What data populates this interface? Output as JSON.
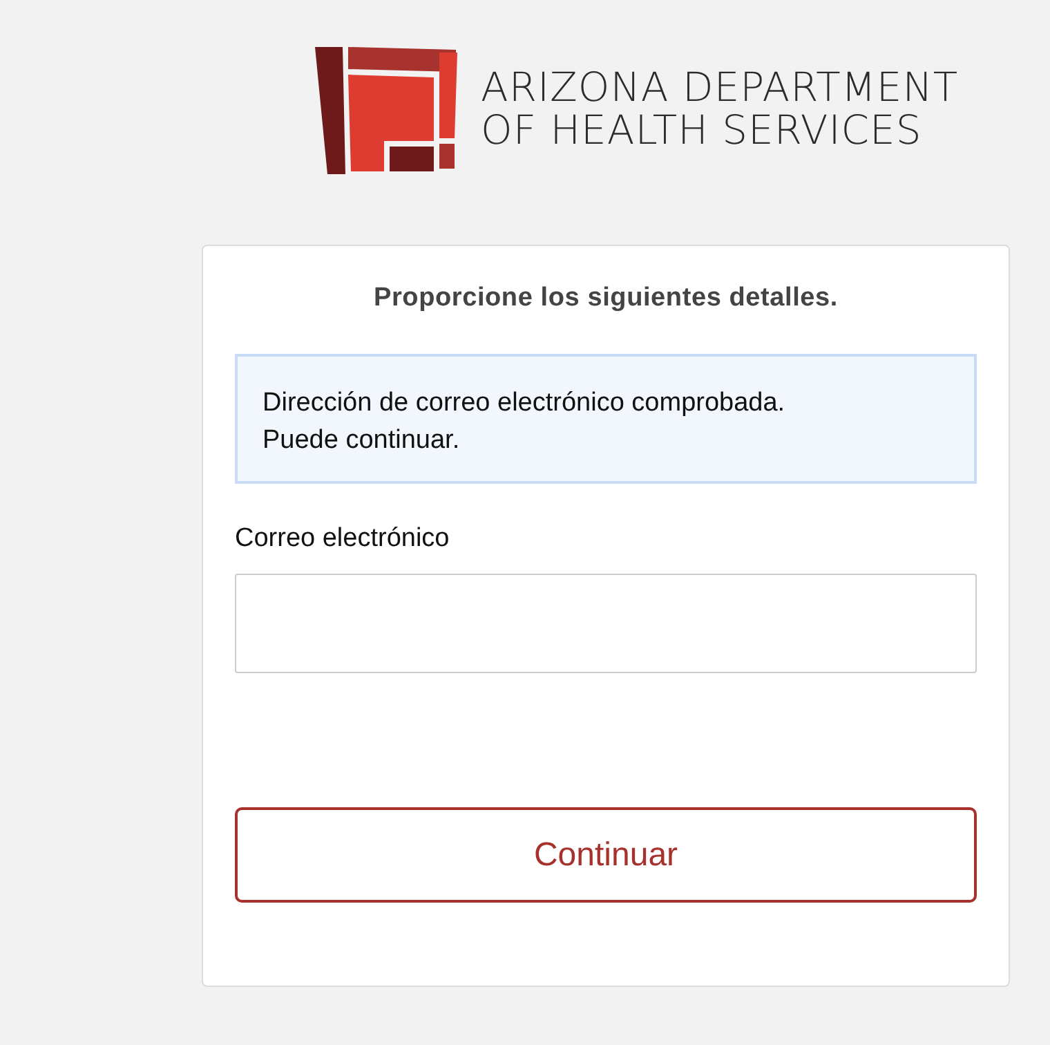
{
  "logo": {
    "lines": [
      "ARIZONA DEPARTMENT",
      "OF HEALTH SERVICES"
    ]
  },
  "form": {
    "heading": "Proporcione los siguientes detalles.",
    "notice": {
      "lines": [
        "Dirección de correo electrónico comprobada.",
        "Puede continuar."
      ]
    },
    "email": {
      "label": "Correo electrónico"
    },
    "button": "Continuar"
  }
}
